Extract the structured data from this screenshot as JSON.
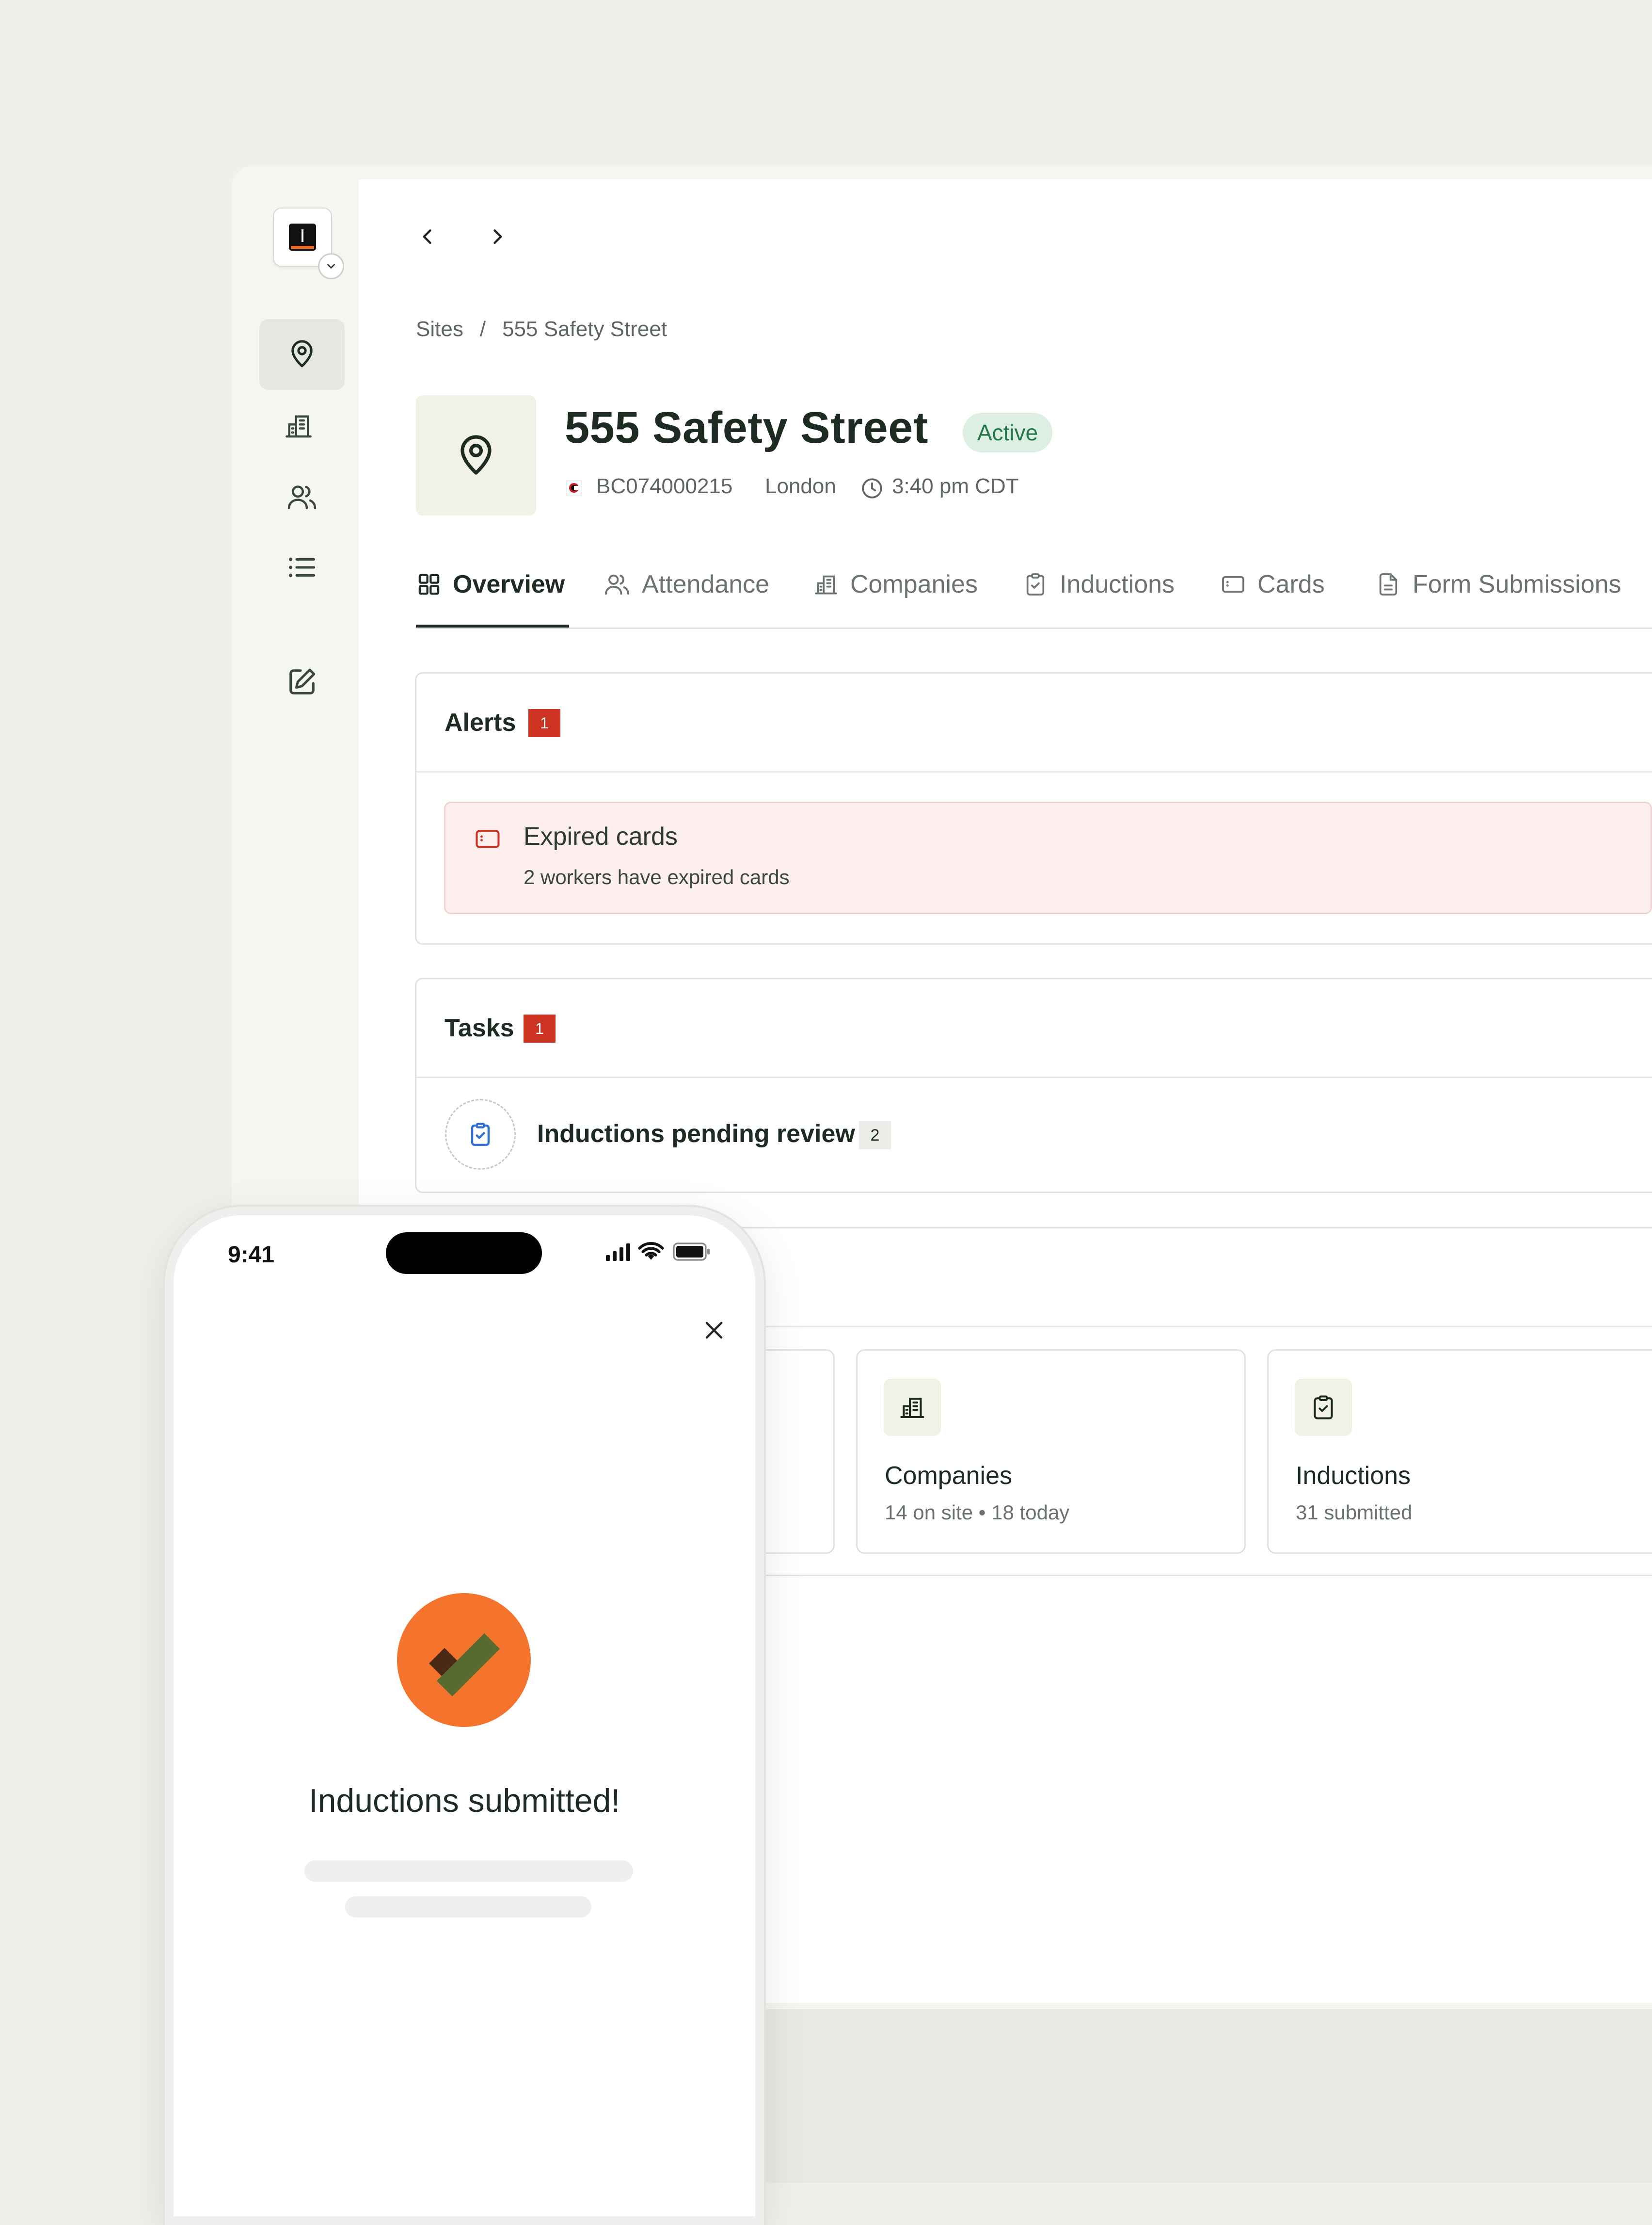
{
  "nav": {
    "back_label": "Back",
    "forward_label": "Forward"
  },
  "breadcrumb": {
    "root": "Sites",
    "separator": "/",
    "current": "555 Safety Street"
  },
  "site": {
    "title": "555 Safety Street",
    "status": "Active",
    "code": "BC074000215",
    "city": "London",
    "time": "3:40 pm CDT"
  },
  "tabs": [
    {
      "label": "Overview",
      "icon": "grid-icon",
      "active": true
    },
    {
      "label": "Attendance",
      "icon": "users-icon"
    },
    {
      "label": "Companies",
      "icon": "building-icon"
    },
    {
      "label": "Inductions",
      "icon": "clipboard-check-icon"
    },
    {
      "label": "Cards",
      "icon": "card-icon"
    },
    {
      "label": "Form Submissions",
      "icon": "document-icon"
    }
  ],
  "alerts": {
    "title": "Alerts",
    "count": "1",
    "items": [
      {
        "icon": "card-icon",
        "title": "Expired cards",
        "text": "2 workers have expired cards"
      }
    ]
  },
  "tasks": {
    "title": "Tasks",
    "count": "1",
    "items": [
      {
        "icon": "clipboard-check-icon",
        "label": "Inductions pending review",
        "count": "2"
      }
    ]
  },
  "stats": [
    {
      "icon": "building-icon",
      "title": "Companies",
      "subtitle": "14 on site • 18 today"
    },
    {
      "icon": "clipboard-check-icon",
      "title": "Inductions",
      "subtitle": "31 submitted"
    }
  ],
  "phone": {
    "status_time": "9:41",
    "success_title": "Inductions submitted!"
  },
  "colors": {
    "accent_dark": "#1d2b22",
    "active_badge": "#237a47",
    "alert_red": "#cc3321",
    "success_orange": "#f4742e",
    "check_green": "#556b2f"
  }
}
